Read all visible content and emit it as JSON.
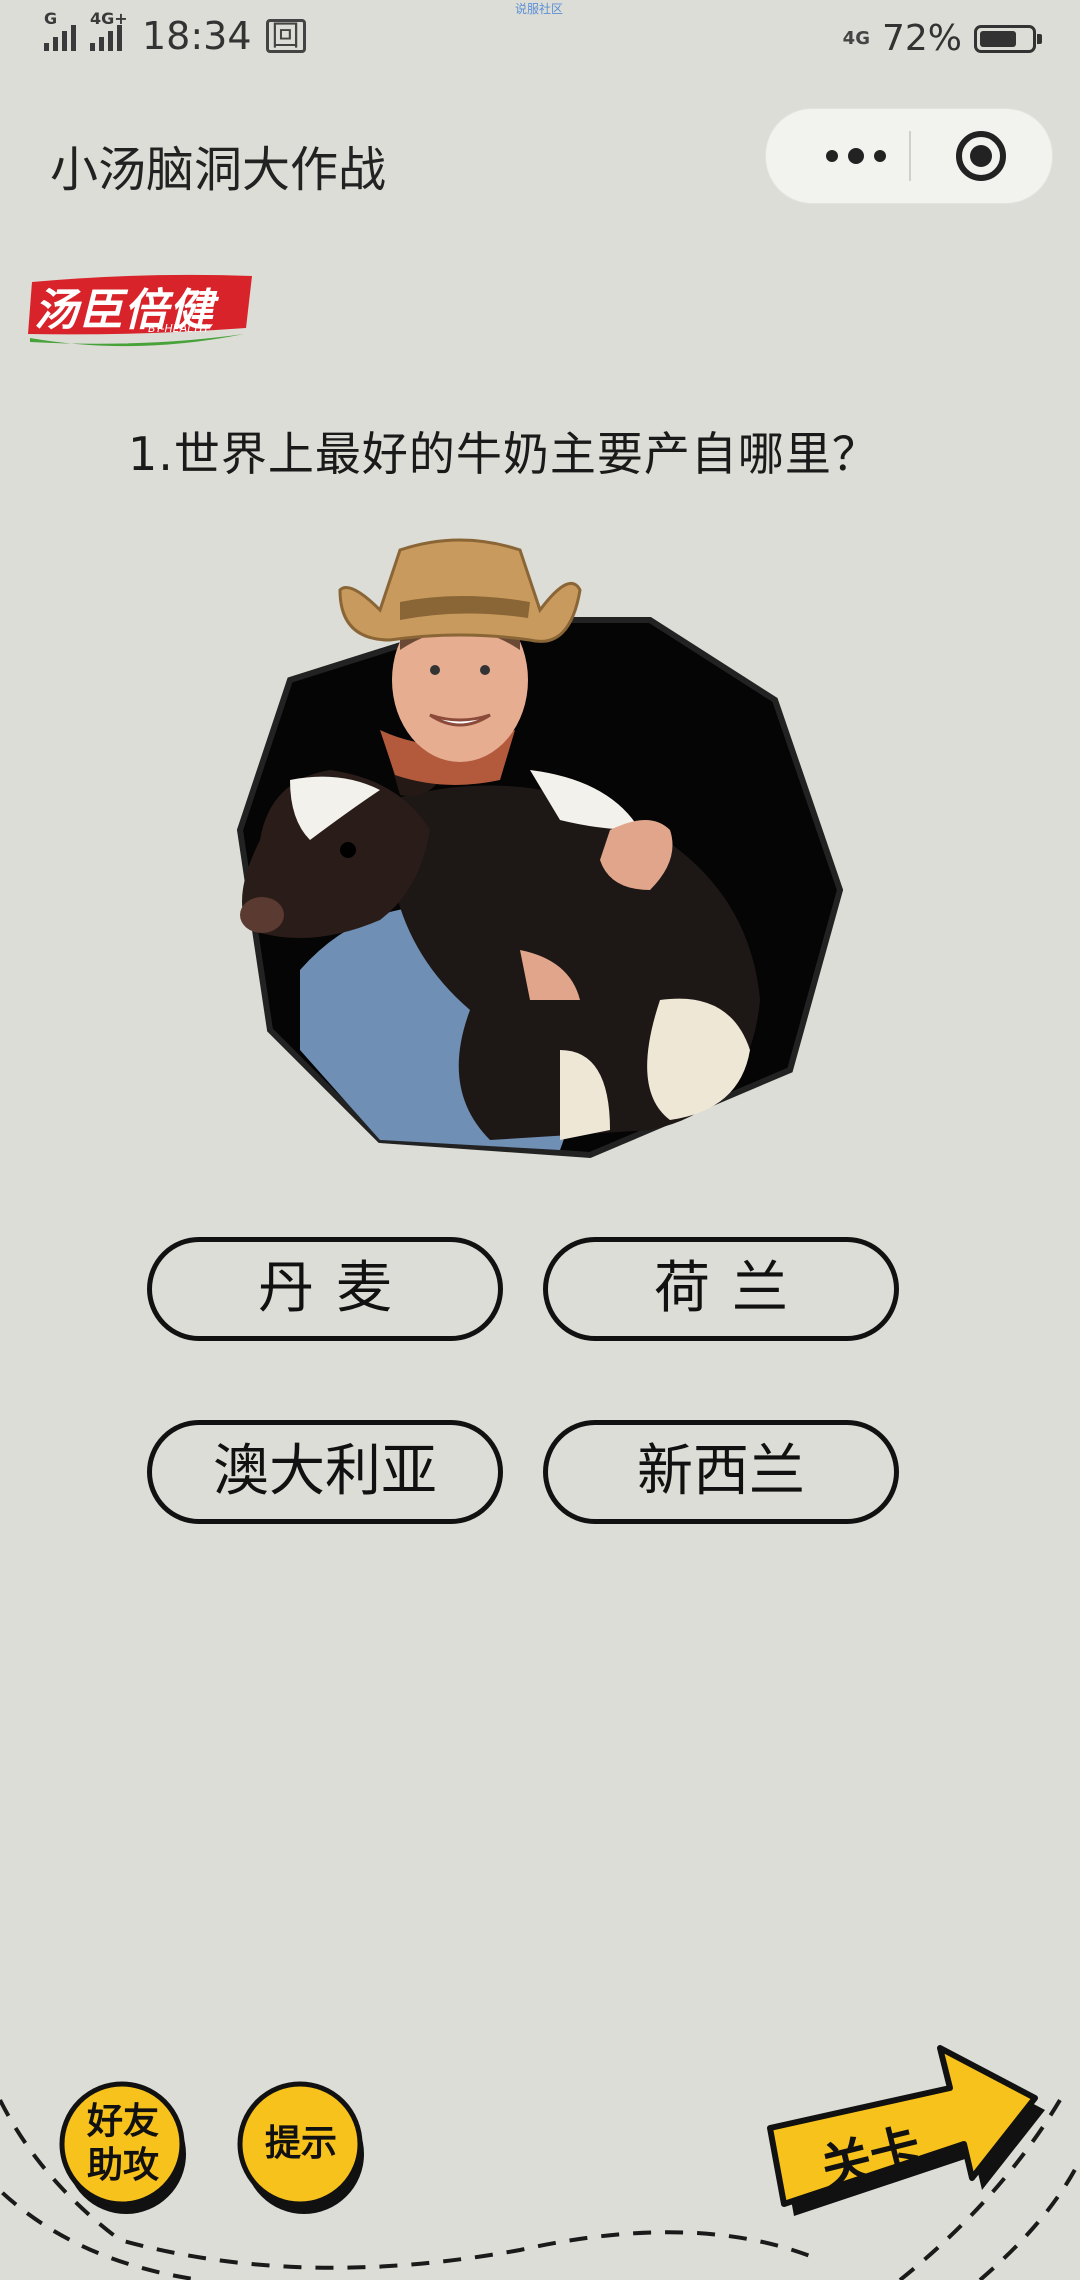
{
  "status_bar": {
    "signal1_tag": "G",
    "signal2_tag": "4G+",
    "time": "18:34",
    "msg_icon": "回",
    "center_text": "说服社区",
    "network": "4G",
    "battery": "72%",
    "battery_level": 0.72
  },
  "nav": {
    "title": "小汤脑洞大作战"
  },
  "logo": {
    "text": "汤臣倍健",
    "sub": "BY-HEALTH"
  },
  "quiz": {
    "question": "1.世界上最好的牛奶主要产自哪里？",
    "options": [
      "丹麦",
      "荷兰",
      "澳大利亚",
      "新西兰"
    ]
  },
  "bottom": {
    "help_label": "好友助攻",
    "hint_label": "提示",
    "level_label": "关卡"
  },
  "colors": {
    "background": "#dcddd6",
    "brand_red": "#d8232a",
    "button_yellow": "#f7c21b"
  }
}
